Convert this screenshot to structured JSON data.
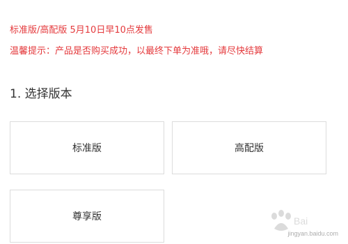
{
  "notices": {
    "line1": "标准版/高配版 5月10日早10点发售",
    "line2": "温馨提示：产品是否购买成功，以最终下单为准哦，请尽快结算"
  },
  "section": {
    "title": "1. 选择版本"
  },
  "options": [
    {
      "label": "标准版"
    },
    {
      "label": "高配版"
    },
    {
      "label": "尊享版"
    }
  ],
  "watermark": {
    "text": "jingyan.baidu.com"
  }
}
